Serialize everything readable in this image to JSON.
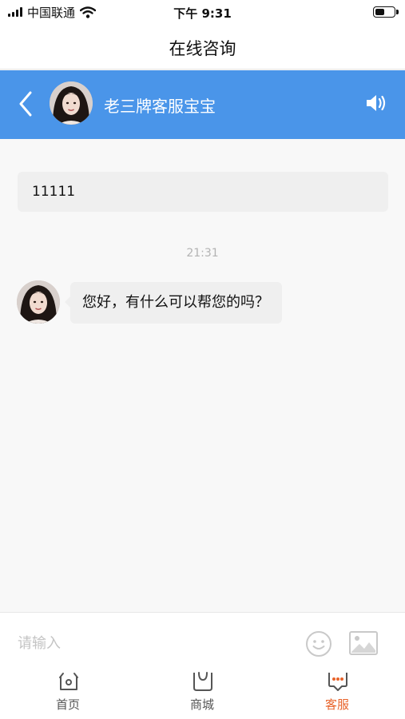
{
  "status_bar": {
    "carrier": "中国联通",
    "time": "下午 9:31",
    "signal_icon": "signal-bars-icon",
    "wifi_icon": "wifi-icon",
    "battery_icon": "battery-icon"
  },
  "page": {
    "title": "在线咨询"
  },
  "chat_header": {
    "agent_name": "老三牌客服宝宝",
    "background_color": "#4a95e9",
    "back_icon": "chevron-left-icon",
    "speaker_icon": "speaker-icon"
  },
  "messages": {
    "user_message": "11111",
    "timestamp": "21:31",
    "agent_message": "您好，有什么可以帮您的吗？"
  },
  "input_bar": {
    "placeholder": "请输入",
    "emoji_icon": "smiley-icon",
    "image_icon": "image-icon"
  },
  "tabs": [
    {
      "label": "首页",
      "icon": "home-icon",
      "active": false
    },
    {
      "label": "商城",
      "icon": "shopping-bag-icon",
      "active": false
    },
    {
      "label": "客服",
      "icon": "chat-bubble-icon",
      "active": true
    }
  ],
  "colors": {
    "accent_blue": "#4a95e9",
    "active_tab": "#e8632a"
  }
}
